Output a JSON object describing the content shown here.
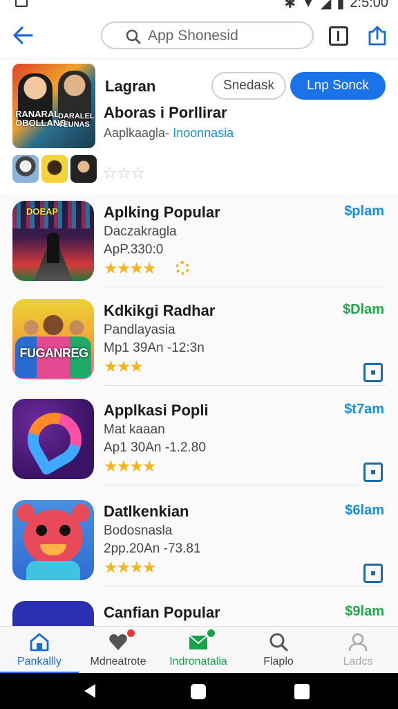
{
  "status_bar": {
    "time": "2:5:00"
  },
  "header": {
    "search_placeholder": "App Shonesid"
  },
  "featured": {
    "name": "Lagran",
    "subtitle": "Aboras i Porllirar",
    "meta_prefix": "Aaplkaagla- ",
    "meta_highlight": "Inoonnasia",
    "art_text_left": "RANARAL OBOLLANG",
    "art_text_right": "DARALEL VEUNAS",
    "secondary_button": "Snedask",
    "primary_button": "Lnp Sonck",
    "rating_empty": "☆☆☆"
  },
  "apps": [
    {
      "title": "Aplking Popular",
      "line2": "Daczakragla",
      "line3": "ApP.330:0",
      "stars": "★★★★",
      "price": "$plam",
      "price_color": "#1a8fd0",
      "art_text": "DOEAP"
    },
    {
      "title": "Kdkikgi Radhar",
      "line2": "Pandlayasia",
      "line3": "Mp1 39An -12:3n",
      "stars": "★★★",
      "price": "$Dlam",
      "price_color": "#22a84a",
      "art_text": "FUGANREG"
    },
    {
      "title": "Applkasi Popli",
      "line2": "Mat kaaan",
      "line3": "Ap1 30An -1.2.80",
      "stars": "★★★★",
      "price": "$t7am",
      "price_color": "#1a8fd0"
    },
    {
      "title": "Datlkenkian",
      "line2": "Bodosnasla",
      "line3": "2pp.20An -73.81",
      "stars": "★★★★",
      "price": "$6lam",
      "price_color": "#1a8fd0"
    },
    {
      "title": "Canfian Popular",
      "price": "$9lam",
      "price_color": "#22a84a"
    }
  ],
  "bottom_nav": [
    {
      "label": "Pankallly"
    },
    {
      "label": "Mdneatrote"
    },
    {
      "label": "Indronatalia"
    },
    {
      "label": "Flaplo"
    },
    {
      "label": "Ladcs"
    }
  ]
}
